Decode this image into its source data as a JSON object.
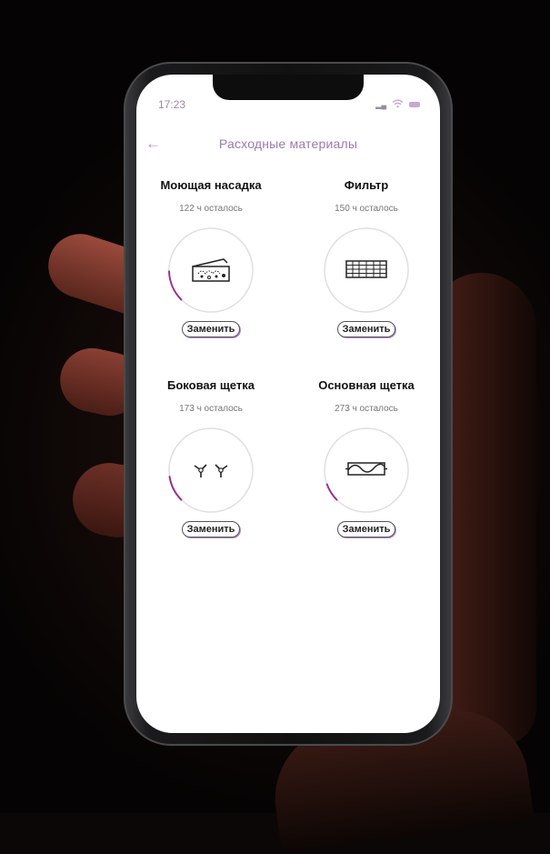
{
  "status_bar": {
    "time": "17:23",
    "signal_icon": "cellular-signal-icon",
    "wifi_icon": "wifi-icon",
    "battery_icon": "battery-icon"
  },
  "header": {
    "back_icon": "back-arrow-icon",
    "title": "Расходные материалы"
  },
  "consumables": [
    {
      "name": "Моющая насадка",
      "remaining": "122 ч осталось",
      "button": "Заменить",
      "icon": "mop-pad-icon",
      "progress": 0.12
    },
    {
      "name": "Фильтр",
      "remaining": "150 ч осталось",
      "button": "Заменить",
      "icon": "filter-icon",
      "progress": 0.0
    },
    {
      "name": "Боковая щетка",
      "remaining": "173 ч осталось",
      "button": "Заменить",
      "icon": "side-brush-icon",
      "progress": 0.1
    },
    {
      "name": "Основная щетка",
      "remaining": "273 ч осталось",
      "button": "Заменить",
      "icon": "main-brush-icon",
      "progress": 0.07
    }
  ],
  "colors": {
    "accent": "#9b2f8f",
    "title": "#9a7aae",
    "ring": "#e2dde4"
  }
}
